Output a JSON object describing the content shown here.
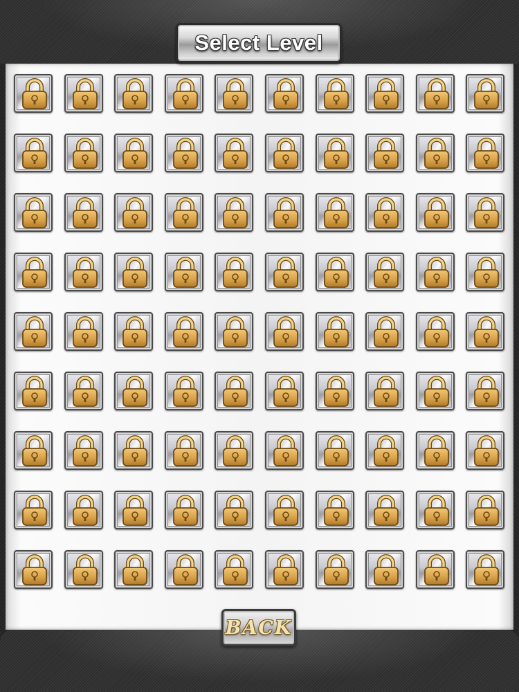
{
  "header": {
    "title": "Select Level"
  },
  "levels": {
    "rows": 9,
    "columns": 10,
    "total": 90,
    "state": "locked",
    "icon": "padlock-icon"
  },
  "footer": {
    "back_label": "BACK"
  },
  "colors": {
    "lock_gold": "#d9a24a",
    "lock_outline": "#6b4a14",
    "button_silver": "#c8c8cf"
  }
}
